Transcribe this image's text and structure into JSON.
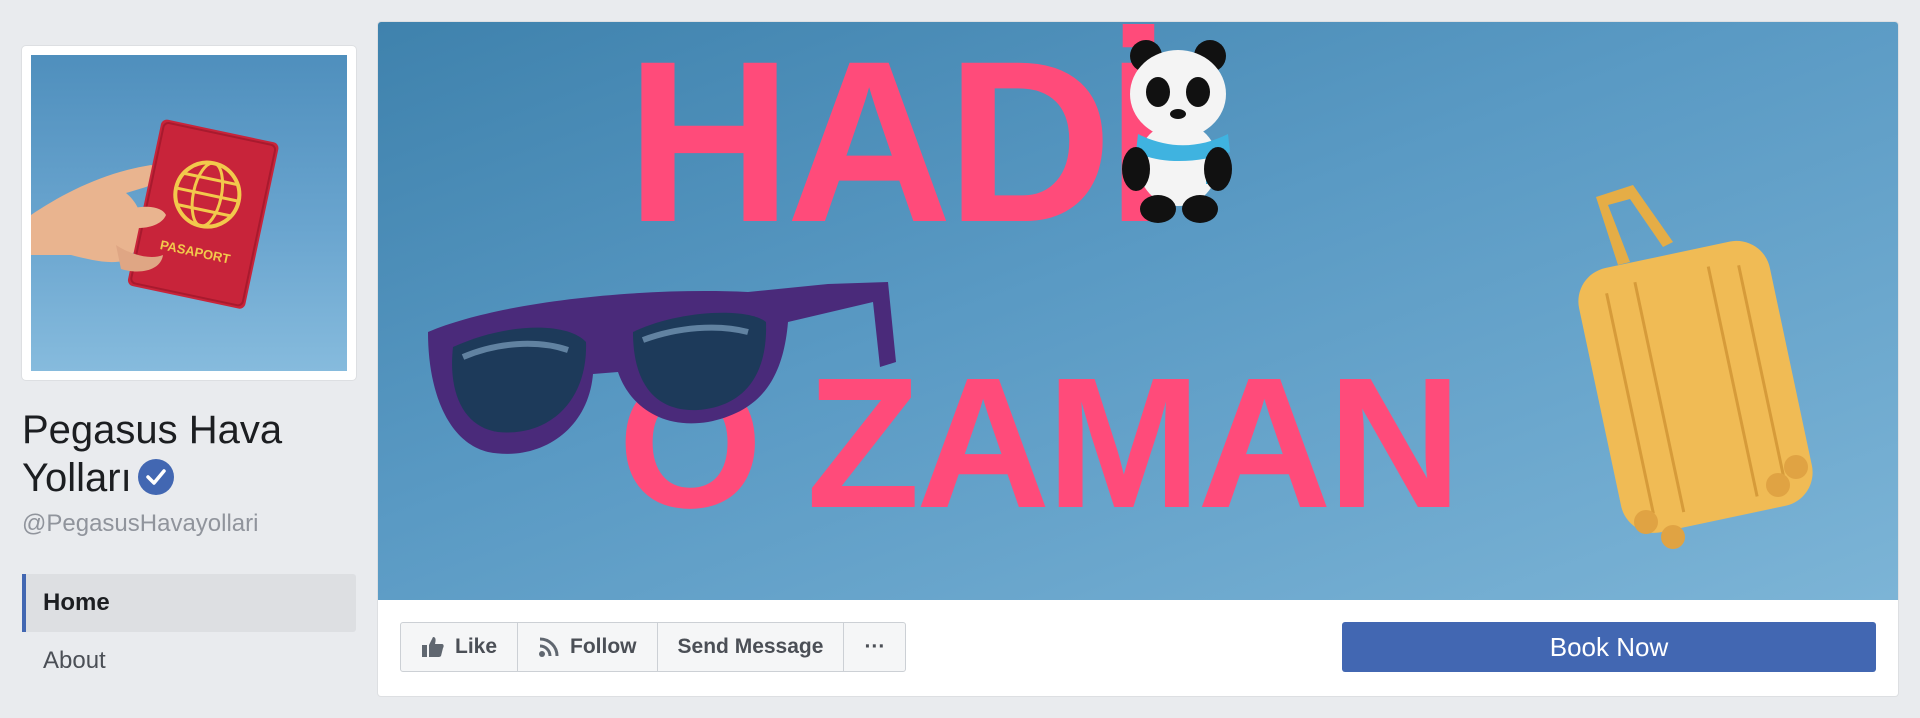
{
  "page": {
    "name": "Pegasus Hava Yolları",
    "handle": "@PegasusHavayollari",
    "verified_icon": "verified-badge-icon"
  },
  "profile_image": {
    "passport_text": "PASAPORT",
    "colors": {
      "passport": "#c8243a",
      "emblem": "#f2c94c"
    }
  },
  "nav": {
    "items": [
      {
        "label": "Home",
        "active": true
      },
      {
        "label": "About",
        "active": false
      }
    ]
  },
  "cover": {
    "headline_line1": "HADİ",
    "headline_line2": "O ZAMAN",
    "headline_color": "#ff4b7a",
    "background": "#5a9ac4"
  },
  "actions": {
    "like_label": "Like",
    "follow_label": "Follow",
    "message_label": "Send Message",
    "more_label": "···",
    "book_label": "Book Now"
  },
  "colors": {
    "brand": "#4267b2",
    "page_bg": "#e9ebee"
  }
}
